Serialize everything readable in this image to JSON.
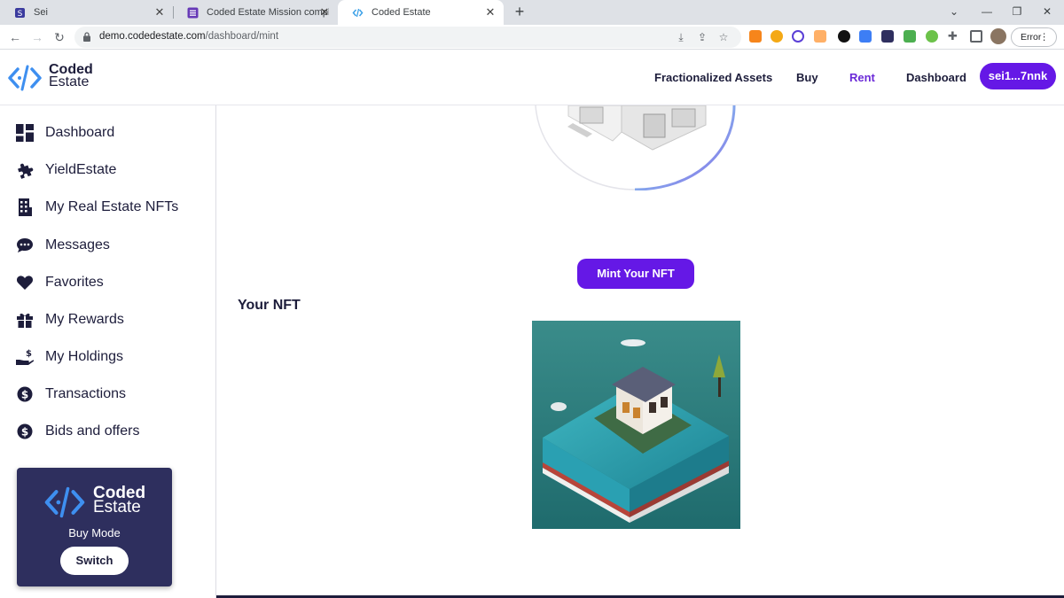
{
  "browser": {
    "tabs": [
      {
        "title": "Sei"
      },
      {
        "title": "Coded Estate Mission completion"
      },
      {
        "title": "Coded Estate"
      }
    ],
    "url_domain": "demo.codedestate.com",
    "url_path": "/dashboard/mint",
    "error_label": "Error"
  },
  "header": {
    "brand_line1": "Coded",
    "brand_line2": "Estate",
    "nav": [
      "Fractionalized Assets",
      "Buy",
      "Rent",
      "Dashboard"
    ],
    "active_nav": "Rent",
    "wallet": "sei1...7nnk",
    "accent": "#6518e6"
  },
  "sidebar": {
    "items": [
      {
        "label": "Dashboard",
        "icon": "dashboard-grid-icon"
      },
      {
        "label": "YieldEstate",
        "icon": "puzzle-icon"
      },
      {
        "label": "My Real Estate NFTs",
        "icon": "building-icon"
      },
      {
        "label": "Messages",
        "icon": "chat-icon"
      },
      {
        "label": "Favorites",
        "icon": "heart-icon"
      },
      {
        "label": "My Rewards",
        "icon": "gift-icon"
      },
      {
        "label": "My Holdings",
        "icon": "hand-dollar-icon"
      },
      {
        "label": "Transactions",
        "icon": "dollar-circle-icon"
      },
      {
        "label": "Bids and offers",
        "icon": "dollar-circle-icon"
      }
    ],
    "mode_card": {
      "logo_line1": "Coded",
      "logo_line2": "Estate",
      "mode": "Buy Mode",
      "switch": "Switch"
    }
  },
  "main": {
    "mint_button": "Mint Your NFT",
    "your_nft_heading": "Your NFT"
  }
}
